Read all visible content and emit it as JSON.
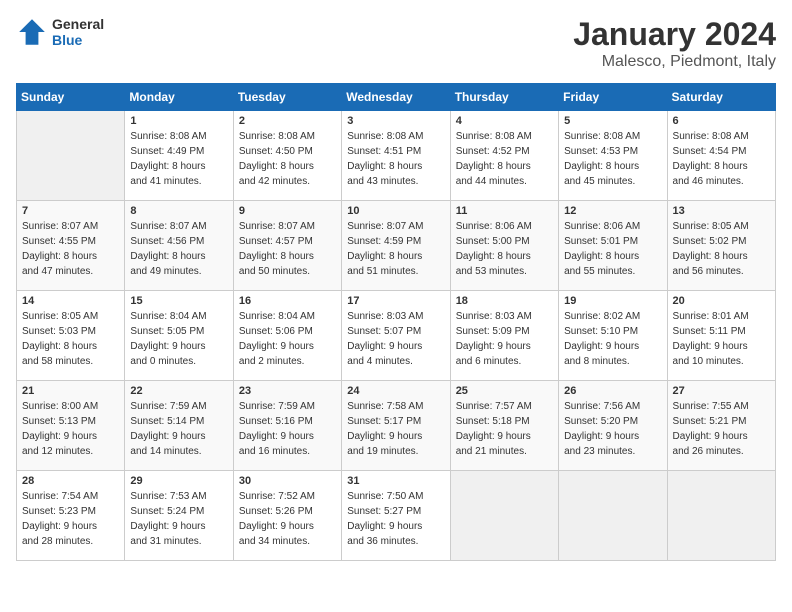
{
  "logo": {
    "general": "General",
    "blue": "Blue"
  },
  "title": "January 2024",
  "subtitle": "Malesco, Piedmont, Italy",
  "days_header": [
    "Sunday",
    "Monday",
    "Tuesday",
    "Wednesday",
    "Thursday",
    "Friday",
    "Saturday"
  ],
  "weeks": [
    [
      {
        "day": "",
        "info": ""
      },
      {
        "day": "1",
        "info": "Sunrise: 8:08 AM\nSunset: 4:49 PM\nDaylight: 8 hours\nand 41 minutes."
      },
      {
        "day": "2",
        "info": "Sunrise: 8:08 AM\nSunset: 4:50 PM\nDaylight: 8 hours\nand 42 minutes."
      },
      {
        "day": "3",
        "info": "Sunrise: 8:08 AM\nSunset: 4:51 PM\nDaylight: 8 hours\nand 43 minutes."
      },
      {
        "day": "4",
        "info": "Sunrise: 8:08 AM\nSunset: 4:52 PM\nDaylight: 8 hours\nand 44 minutes."
      },
      {
        "day": "5",
        "info": "Sunrise: 8:08 AM\nSunset: 4:53 PM\nDaylight: 8 hours\nand 45 minutes."
      },
      {
        "day": "6",
        "info": "Sunrise: 8:08 AM\nSunset: 4:54 PM\nDaylight: 8 hours\nand 46 minutes."
      }
    ],
    [
      {
        "day": "7",
        "info": "Sunrise: 8:07 AM\nSunset: 4:55 PM\nDaylight: 8 hours\nand 47 minutes."
      },
      {
        "day": "8",
        "info": "Sunrise: 8:07 AM\nSunset: 4:56 PM\nDaylight: 8 hours\nand 49 minutes."
      },
      {
        "day": "9",
        "info": "Sunrise: 8:07 AM\nSunset: 4:57 PM\nDaylight: 8 hours\nand 50 minutes."
      },
      {
        "day": "10",
        "info": "Sunrise: 8:07 AM\nSunset: 4:59 PM\nDaylight: 8 hours\nand 51 minutes."
      },
      {
        "day": "11",
        "info": "Sunrise: 8:06 AM\nSunset: 5:00 PM\nDaylight: 8 hours\nand 53 minutes."
      },
      {
        "day": "12",
        "info": "Sunrise: 8:06 AM\nSunset: 5:01 PM\nDaylight: 8 hours\nand 55 minutes."
      },
      {
        "day": "13",
        "info": "Sunrise: 8:05 AM\nSunset: 5:02 PM\nDaylight: 8 hours\nand 56 minutes."
      }
    ],
    [
      {
        "day": "14",
        "info": "Sunrise: 8:05 AM\nSunset: 5:03 PM\nDaylight: 8 hours\nand 58 minutes."
      },
      {
        "day": "15",
        "info": "Sunrise: 8:04 AM\nSunset: 5:05 PM\nDaylight: 9 hours\nand 0 minutes."
      },
      {
        "day": "16",
        "info": "Sunrise: 8:04 AM\nSunset: 5:06 PM\nDaylight: 9 hours\nand 2 minutes."
      },
      {
        "day": "17",
        "info": "Sunrise: 8:03 AM\nSunset: 5:07 PM\nDaylight: 9 hours\nand 4 minutes."
      },
      {
        "day": "18",
        "info": "Sunrise: 8:03 AM\nSunset: 5:09 PM\nDaylight: 9 hours\nand 6 minutes."
      },
      {
        "day": "19",
        "info": "Sunrise: 8:02 AM\nSunset: 5:10 PM\nDaylight: 9 hours\nand 8 minutes."
      },
      {
        "day": "20",
        "info": "Sunrise: 8:01 AM\nSunset: 5:11 PM\nDaylight: 9 hours\nand 10 minutes."
      }
    ],
    [
      {
        "day": "21",
        "info": "Sunrise: 8:00 AM\nSunset: 5:13 PM\nDaylight: 9 hours\nand 12 minutes."
      },
      {
        "day": "22",
        "info": "Sunrise: 7:59 AM\nSunset: 5:14 PM\nDaylight: 9 hours\nand 14 minutes."
      },
      {
        "day": "23",
        "info": "Sunrise: 7:59 AM\nSunset: 5:16 PM\nDaylight: 9 hours\nand 16 minutes."
      },
      {
        "day": "24",
        "info": "Sunrise: 7:58 AM\nSunset: 5:17 PM\nDaylight: 9 hours\nand 19 minutes."
      },
      {
        "day": "25",
        "info": "Sunrise: 7:57 AM\nSunset: 5:18 PM\nDaylight: 9 hours\nand 21 minutes."
      },
      {
        "day": "26",
        "info": "Sunrise: 7:56 AM\nSunset: 5:20 PM\nDaylight: 9 hours\nand 23 minutes."
      },
      {
        "day": "27",
        "info": "Sunrise: 7:55 AM\nSunset: 5:21 PM\nDaylight: 9 hours\nand 26 minutes."
      }
    ],
    [
      {
        "day": "28",
        "info": "Sunrise: 7:54 AM\nSunset: 5:23 PM\nDaylight: 9 hours\nand 28 minutes."
      },
      {
        "day": "29",
        "info": "Sunrise: 7:53 AM\nSunset: 5:24 PM\nDaylight: 9 hours\nand 31 minutes."
      },
      {
        "day": "30",
        "info": "Sunrise: 7:52 AM\nSunset: 5:26 PM\nDaylight: 9 hours\nand 34 minutes."
      },
      {
        "day": "31",
        "info": "Sunrise: 7:50 AM\nSunset: 5:27 PM\nDaylight: 9 hours\nand 36 minutes."
      },
      {
        "day": "",
        "info": ""
      },
      {
        "day": "",
        "info": ""
      },
      {
        "day": "",
        "info": ""
      }
    ]
  ]
}
